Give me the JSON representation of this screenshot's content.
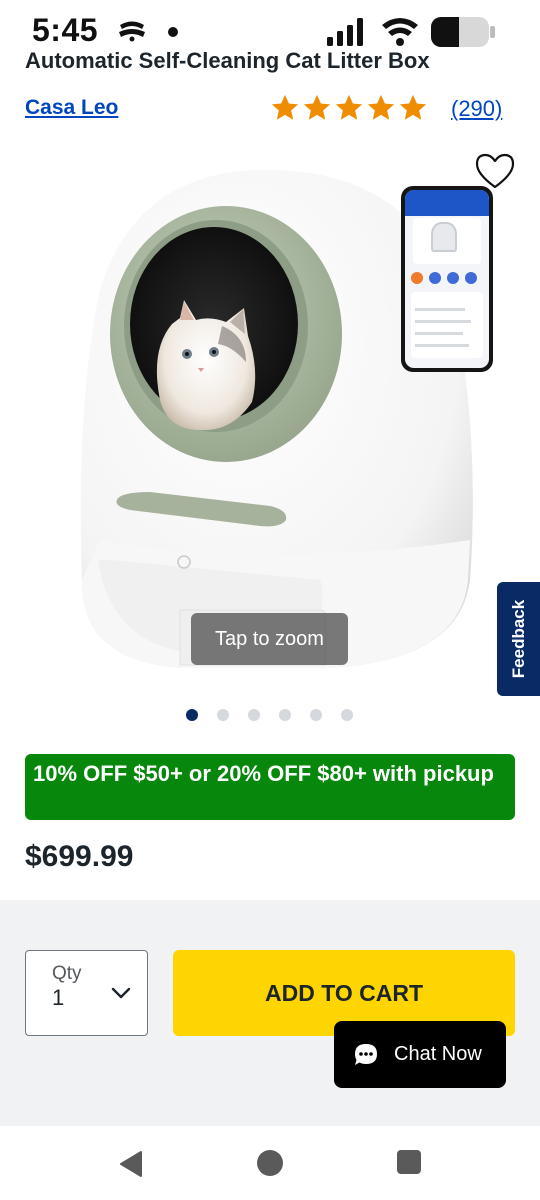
{
  "status_bar": {
    "time": "5:45",
    "icons": [
      "cast-icon",
      "notification-dot",
      "signal-icon",
      "wifi-icon",
      "battery-icon"
    ]
  },
  "product": {
    "title": "Automatic Self-Cleaning Cat Litter Box",
    "brand": "Casa Leo",
    "rating": 5,
    "review_count": "(290)",
    "price": "$699.99"
  },
  "image": {
    "tap_to_zoom": "Tap to zoom",
    "carousel_total": 6,
    "carousel_active": 1
  },
  "feedback": {
    "label": "Feedback"
  },
  "promo": {
    "text": "10% OFF $50+ or 20% OFF $80+ with pickup"
  },
  "cart": {
    "qty_label": "Qty",
    "qty_value": "1",
    "add_to_cart_label": "ADD TO CART"
  },
  "chat": {
    "label": "Chat Now"
  },
  "colors": {
    "brand_blue": "#0046be",
    "navy": "#0a2a66",
    "star": "#f08c00",
    "promo_green": "#07880c",
    "cart_yellow": "#ffd500"
  }
}
